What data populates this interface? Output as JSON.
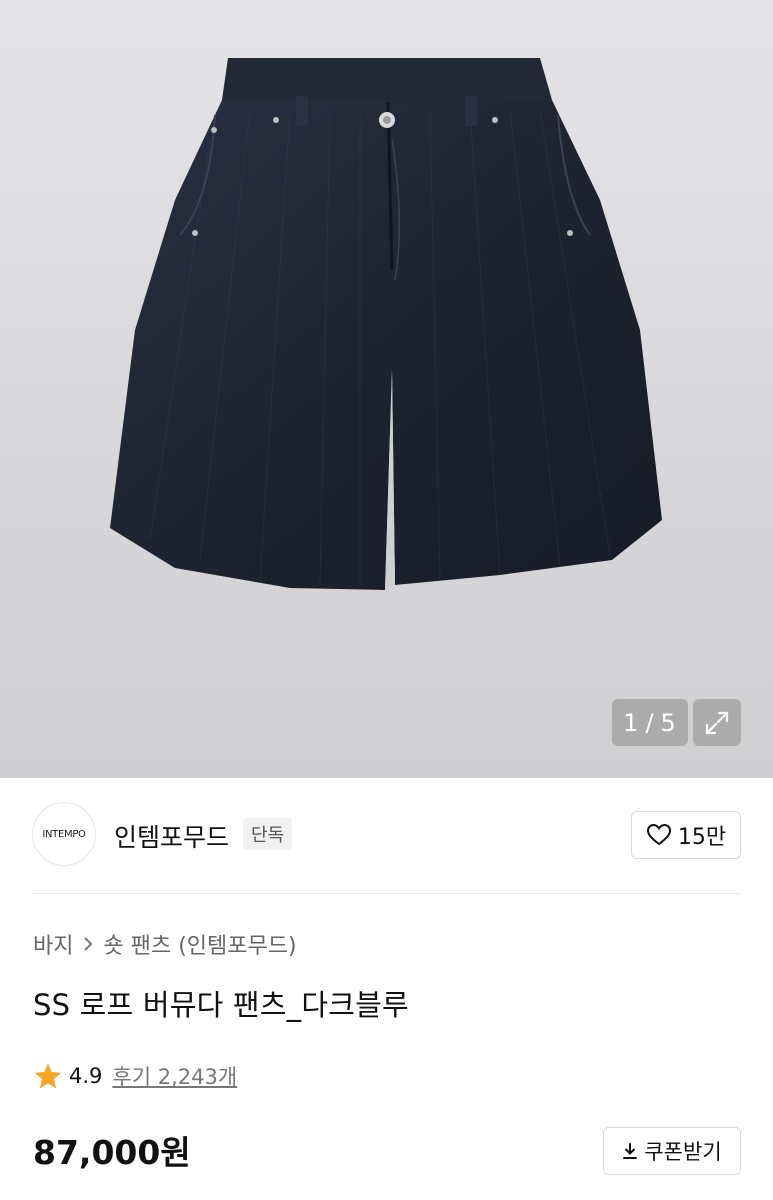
{
  "gallery": {
    "current": "1",
    "separator": "/",
    "total": "5",
    "expand_icon": "expand-icon"
  },
  "brand": {
    "logo_text": "INTEMPO",
    "name": "인템포무드",
    "badge": "단독",
    "likes": "15만",
    "heart_icon": "heart-icon"
  },
  "breadcrumb": {
    "items": [
      "바지",
      "숏 팬츠 (인템포무드)"
    ],
    "chevron_icon": "chevron-right-icon"
  },
  "product": {
    "title": "SS 로프 버뮤다 팬츠_다크블루",
    "rating": "4.9",
    "reviews": "후기 2,243개",
    "price": "87,000원",
    "coupon_label": "쿠폰받기",
    "star_color": "#f5a623"
  }
}
